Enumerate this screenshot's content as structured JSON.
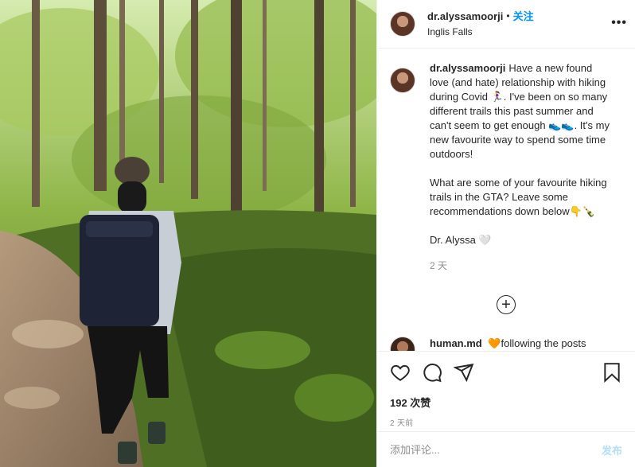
{
  "post": {
    "username": "dr.alyssamoorji",
    "dot": "•",
    "follow_label": "关注",
    "location": "Inglis Falls",
    "more_label": "•••"
  },
  "caption": {
    "username": "dr.alyssamoorji",
    "paragraph1": "Have a new found love (and hate) relationship with hiking during Covid 🏃‍♀️. I've been on so many different trails this past summer and can't seem to get enough 👟👟. It's my new favourite way to spend some time outdoors!",
    "paragraph2": "What are some of your favourite hiking trails in the GTA? Leave some recommendations down below👇🍾",
    "signature": "Dr. Alyssa 🤍",
    "age": "2 天"
  },
  "load_more": "+",
  "next_comment": {
    "username": "human.md",
    "text": "🧡following the posts"
  },
  "actions": {
    "likes": "192 次赞",
    "time": "2 天前"
  },
  "comment_box": {
    "placeholder": "添加评论...",
    "post_label": "发布"
  },
  "colors": {
    "accent": "#0095f6",
    "post_disabled": "#b2dffc",
    "muted": "#8e8e8e"
  }
}
